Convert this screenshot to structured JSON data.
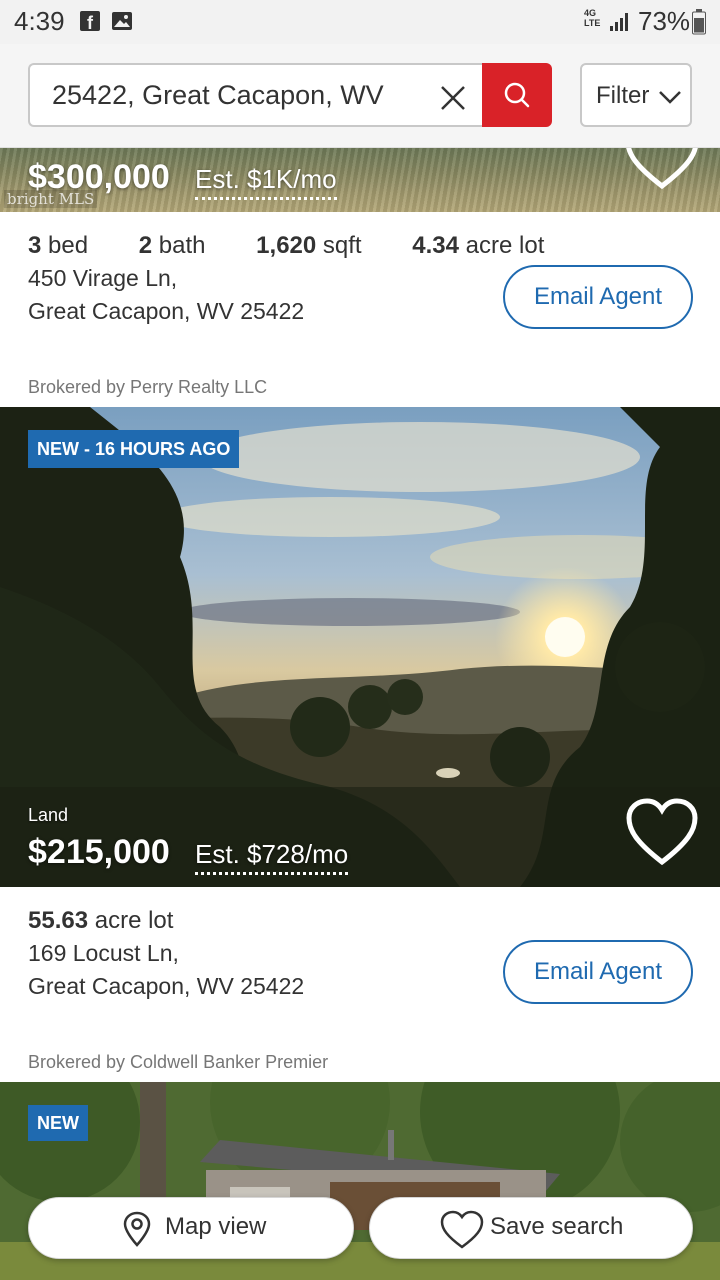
{
  "status_bar": {
    "time": "4:39",
    "network": "4G LTE",
    "battery": "73%"
  },
  "search": {
    "query": "25422, Great Cacapon, WV",
    "filter_label": "Filter"
  },
  "listings": [
    {
      "price": "$300,000",
      "est_payment": "Est. $1K/mo",
      "mls_logo": "bright MLS",
      "beds_value": "3",
      "beds_unit": "bed",
      "baths_value": "2",
      "baths_unit": "bath",
      "sqft_value": "1,620",
      "sqft_unit": "sqft",
      "lot_value": "4.34",
      "lot_unit": "acre lot",
      "address_line1": "450 Virage Ln,",
      "address_line2": "Great Cacapon, WV 25422",
      "email_label": "Email Agent",
      "broker": "Brokered by Perry Realty LLC"
    },
    {
      "badge": "NEW - 16 HOURS AGO",
      "property_type": "Land",
      "price": "$215,000",
      "est_payment": "Est. $728/mo",
      "lot_value": "55.63",
      "lot_unit": "acre lot",
      "address_line1": "169 Locust Ln,",
      "address_line2": "Great Cacapon, WV 25422",
      "email_label": "Email Agent",
      "broker": "Brokered by Coldwell Banker Premier"
    },
    {
      "badge": "NEW"
    }
  ],
  "bottom_actions": {
    "map_view": "Map view",
    "save_search": "Save search"
  },
  "colors": {
    "brand_red": "#d92228",
    "link_blue": "#1f6ab0"
  },
  "icons": [
    "facebook-icon",
    "gallery-icon",
    "signal-icon",
    "battery-icon",
    "clear-icon",
    "search-icon",
    "chevron-down-icon",
    "heart-icon",
    "map-pin-icon"
  ]
}
